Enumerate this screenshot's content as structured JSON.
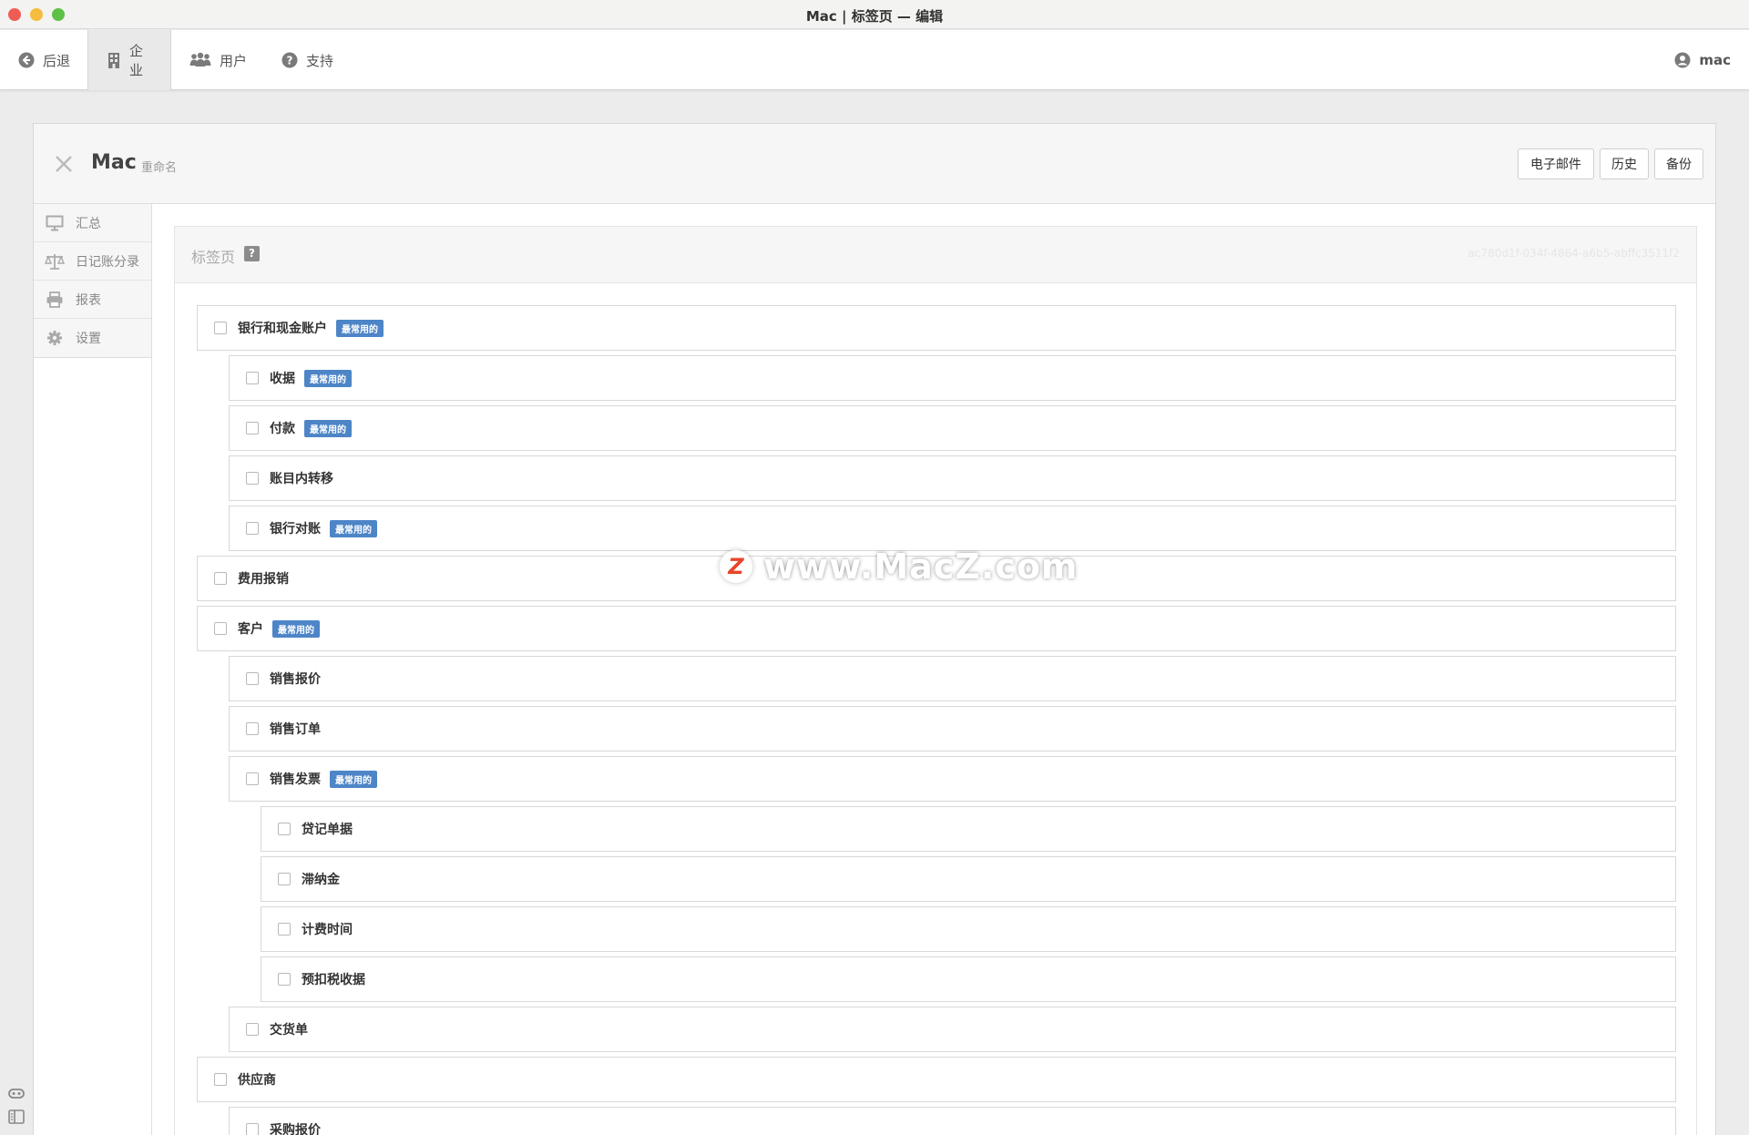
{
  "window": {
    "title": "Mac | 标签页 — 编辑"
  },
  "topnav": {
    "back": "后退",
    "company": "企业",
    "users": "用户",
    "support": "支持",
    "user": "mac"
  },
  "header": {
    "title": "Mac",
    "rename": "重命名",
    "buttons": {
      "email": "电子邮件",
      "history": "历史",
      "backup": "备份"
    }
  },
  "leftmenu": {
    "items": [
      {
        "label": "汇总",
        "icon": "monitor-icon"
      },
      {
        "label": "日记账分录",
        "icon": "scale-icon"
      },
      {
        "label": "报表",
        "icon": "printer-icon"
      },
      {
        "label": "设置",
        "icon": "gear-icon"
      }
    ]
  },
  "card": {
    "title": "标签页",
    "help": "?",
    "uuid": "ac780d1f-034f-4864-a6b5-abffc3511f2"
  },
  "badge_text": "最常用的",
  "tree": [
    {
      "label": "银行和现金账户",
      "level": 0,
      "badge": true
    },
    {
      "label": "收据",
      "level": 1,
      "badge": true
    },
    {
      "label": "付款",
      "level": 1,
      "badge": true
    },
    {
      "label": "账目内转移",
      "level": 1,
      "badge": false
    },
    {
      "label": "银行对账",
      "level": 1,
      "badge": true
    },
    {
      "label": "费用报销",
      "level": 0,
      "badge": false
    },
    {
      "label": "客户",
      "level": 0,
      "badge": true
    },
    {
      "label": "销售报价",
      "level": 1,
      "badge": false
    },
    {
      "label": "销售订单",
      "level": 1,
      "badge": false
    },
    {
      "label": "销售发票",
      "level": 1,
      "badge": true
    },
    {
      "label": "贷记单据",
      "level": 2,
      "badge": false
    },
    {
      "label": "滞纳金",
      "level": 2,
      "badge": false
    },
    {
      "label": "计费时间",
      "level": 2,
      "badge": false
    },
    {
      "label": "预扣税收据",
      "level": 2,
      "badge": false
    },
    {
      "label": "交货单",
      "level": 1,
      "badge": false
    },
    {
      "label": "供应商",
      "level": 0,
      "badge": false
    },
    {
      "label": "采购报价",
      "level": 1,
      "badge": false
    }
  ],
  "watermark": {
    "text": "www.MacZ.com",
    "logo": "Z"
  },
  "colors": {
    "badge": "#4d85c7",
    "traffic_red": "#ee5d55",
    "traffic_yellow": "#f4bd40",
    "traffic_green": "#5cc146"
  }
}
